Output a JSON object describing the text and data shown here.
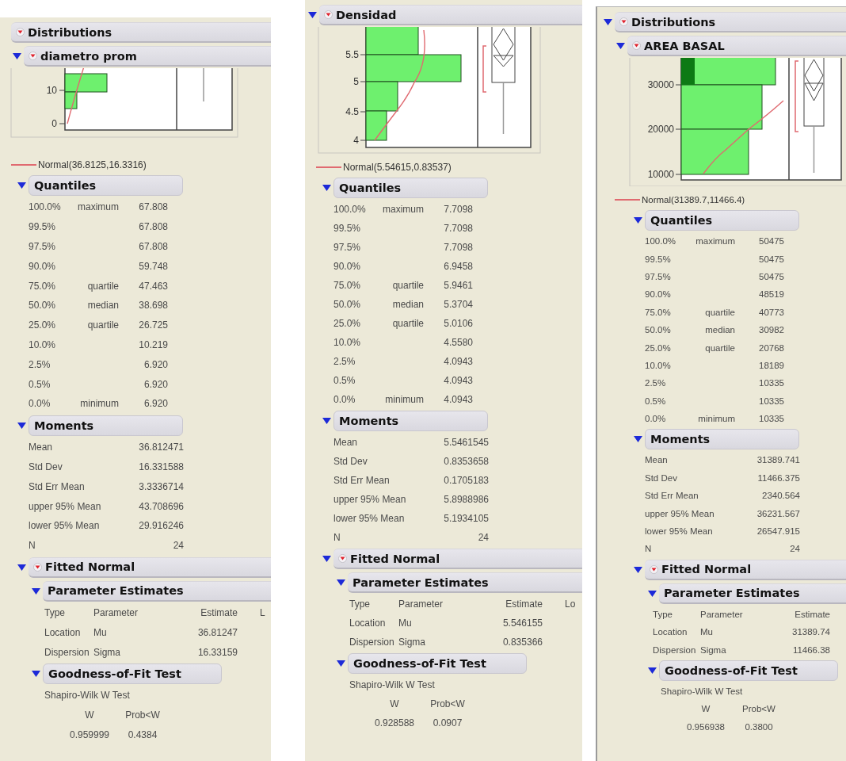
{
  "panels": [
    {
      "headers": [
        {
          "title": "Distributions",
          "disclosure": false,
          "menu": true
        },
        {
          "title": "diametro prom",
          "disclosure": true,
          "menu": true
        }
      ],
      "plot": {
        "ticks": [
          "10",
          "0"
        ]
      },
      "legend": "Normal(36.8125,16.3316)",
      "quantiles": {
        "title": "Quantiles",
        "disclosure": true,
        "rows": [
          [
            "100.0%",
            "maximum",
            "67.808"
          ],
          [
            "99.5%",
            "",
            "67.808"
          ],
          [
            "97.5%",
            "",
            "67.808"
          ],
          [
            "90.0%",
            "",
            "59.748"
          ],
          [
            "75.0%",
            "quartile",
            "47.463"
          ],
          [
            "50.0%",
            "median",
            "38.698"
          ],
          [
            "25.0%",
            "quartile",
            "26.725"
          ],
          [
            "10.0%",
            "",
            "10.219"
          ],
          [
            "2.5%",
            "",
            "6.920"
          ],
          [
            "0.5%",
            "",
            "6.920"
          ],
          [
            "0.0%",
            "minimum",
            "6.920"
          ]
        ]
      },
      "moments": {
        "title": "Moments",
        "disclosure": true,
        "rows": [
          [
            "Mean",
            "36.812471"
          ],
          [
            "Std Dev",
            "16.331588"
          ],
          [
            "Std Err Mean",
            "3.3336714"
          ],
          [
            "upper 95% Mean",
            "43.708696"
          ],
          [
            "lower 95% Mean",
            "29.916246"
          ],
          [
            "N",
            "24"
          ]
        ]
      },
      "fitted": {
        "title": "Fitted Normal",
        "disclosure": true,
        "menu": true,
        "estimates": {
          "title": "Parameter Estimates",
          "disclosure": true,
          "columns": [
            "Type",
            "Parameter",
            "Estimate",
            "L"
          ],
          "rows": [
            [
              "Location",
              "Mu",
              "36.81247"
            ],
            [
              "Dispersion",
              "Sigma",
              "16.33159"
            ]
          ]
        },
        "gof": {
          "title": "Goodness-of-Fit Test",
          "disclosure": true,
          "test": "Shapiro-Wilk W Test",
          "columns": [
            "W",
            "Prob<W"
          ],
          "values": [
            "0.959999",
            "0.4384"
          ]
        }
      }
    },
    {
      "headers": [
        {
          "title": "Densidad",
          "disclosure": true,
          "menu": true
        }
      ],
      "plot": {
        "ticks": [
          "5.5",
          "5",
          "4.5",
          "4"
        ]
      },
      "legend": "Normal(5.54615,0.83537)",
      "quantiles": {
        "title": "Quantiles",
        "disclosure": true,
        "rows": [
          [
            "100.0%",
            "maximum",
            "7.7098"
          ],
          [
            "99.5%",
            "",
            "7.7098"
          ],
          [
            "97.5%",
            "",
            "7.7098"
          ],
          [
            "90.0%",
            "",
            "6.9458"
          ],
          [
            "75.0%",
            "quartile",
            "5.9461"
          ],
          [
            "50.0%",
            "median",
            "5.3704"
          ],
          [
            "25.0%",
            "quartile",
            "5.0106"
          ],
          [
            "10.0%",
            "",
            "4.5580"
          ],
          [
            "2.5%",
            "",
            "4.0943"
          ],
          [
            "0.5%",
            "",
            "4.0943"
          ],
          [
            "0.0%",
            "minimum",
            "4.0943"
          ]
        ]
      },
      "moments": {
        "title": "Moments",
        "disclosure": true,
        "rows": [
          [
            "Mean",
            "5.5461545"
          ],
          [
            "Std Dev",
            "0.8353658"
          ],
          [
            "Std Err Mean",
            "0.1705183"
          ],
          [
            "upper 95% Mean",
            "5.8988986"
          ],
          [
            "lower 95% Mean",
            "5.1934105"
          ],
          [
            "N",
            "24"
          ]
        ]
      },
      "fitted": {
        "title": "Fitted Normal",
        "disclosure": true,
        "menu": true,
        "estimates": {
          "title": "Parameter Estimates",
          "disclosure": true,
          "columns": [
            "Type",
            "Parameter",
            "Estimate",
            "Lo"
          ],
          "rows": [
            [
              "Location",
              "Mu",
              "5.546155"
            ],
            [
              "Dispersion",
              "Sigma",
              "0.835366"
            ]
          ]
        },
        "gof": {
          "title": "Goodness-of-Fit Test",
          "disclosure": true,
          "test": "Shapiro-Wilk W Test",
          "columns": [
            "W",
            "Prob<W"
          ],
          "values": [
            "0.928588",
            "0.0907"
          ]
        }
      }
    },
    {
      "headers": [
        {
          "title": "Distributions",
          "disclosure": true,
          "menu": true
        },
        {
          "title": "AREA BASAL",
          "disclosure": true,
          "menu": true
        }
      ],
      "plot": {
        "ticks": [
          "30000",
          "20000",
          "10000"
        ]
      },
      "legend": "Normal(31389.7,11466.4)",
      "quantiles": {
        "title": "Quantiles",
        "disclosure": true,
        "rows": [
          [
            "100.0%",
            "maximum",
            "50475"
          ],
          [
            "99.5%",
            "",
            "50475"
          ],
          [
            "97.5%",
            "",
            "50475"
          ],
          [
            "90.0%",
            "",
            "48519"
          ],
          [
            "75.0%",
            "quartile",
            "40773"
          ],
          [
            "50.0%",
            "median",
            "30982"
          ],
          [
            "25.0%",
            "quartile",
            "20768"
          ],
          [
            "10.0%",
            "",
            "18189"
          ],
          [
            "2.5%",
            "",
            "10335"
          ],
          [
            "0.5%",
            "",
            "10335"
          ],
          [
            "0.0%",
            "minimum",
            "10335"
          ]
        ]
      },
      "moments": {
        "title": "Moments",
        "disclosure": true,
        "rows": [
          [
            "Mean",
            "31389.741"
          ],
          [
            "Std Dev",
            "11466.375"
          ],
          [
            "Std Err Mean",
            "2340.564"
          ],
          [
            "upper 95% Mean",
            "36231.567"
          ],
          [
            "lower 95% Mean",
            "26547.915"
          ],
          [
            "N",
            "24"
          ]
        ]
      },
      "fitted": {
        "title": "Fitted Normal",
        "disclosure": true,
        "menu": true,
        "estimates": {
          "title": "Parameter Estimates",
          "disclosure": true,
          "columns": [
            "Type",
            "Parameter",
            "Estimate"
          ],
          "rows": [
            [
              "Location",
              "Mu",
              "31389.74"
            ],
            [
              "Dispersion",
              "Sigma",
              "11466.38"
            ]
          ]
        },
        "gof": {
          "title": "Goodness-of-Fit Test",
          "disclosure": true,
          "test": "Shapiro-Wilk W Test",
          "columns": [
            "W",
            "Prob<W"
          ],
          "values": [
            "0.956938",
            "0.3800"
          ]
        }
      }
    }
  ]
}
